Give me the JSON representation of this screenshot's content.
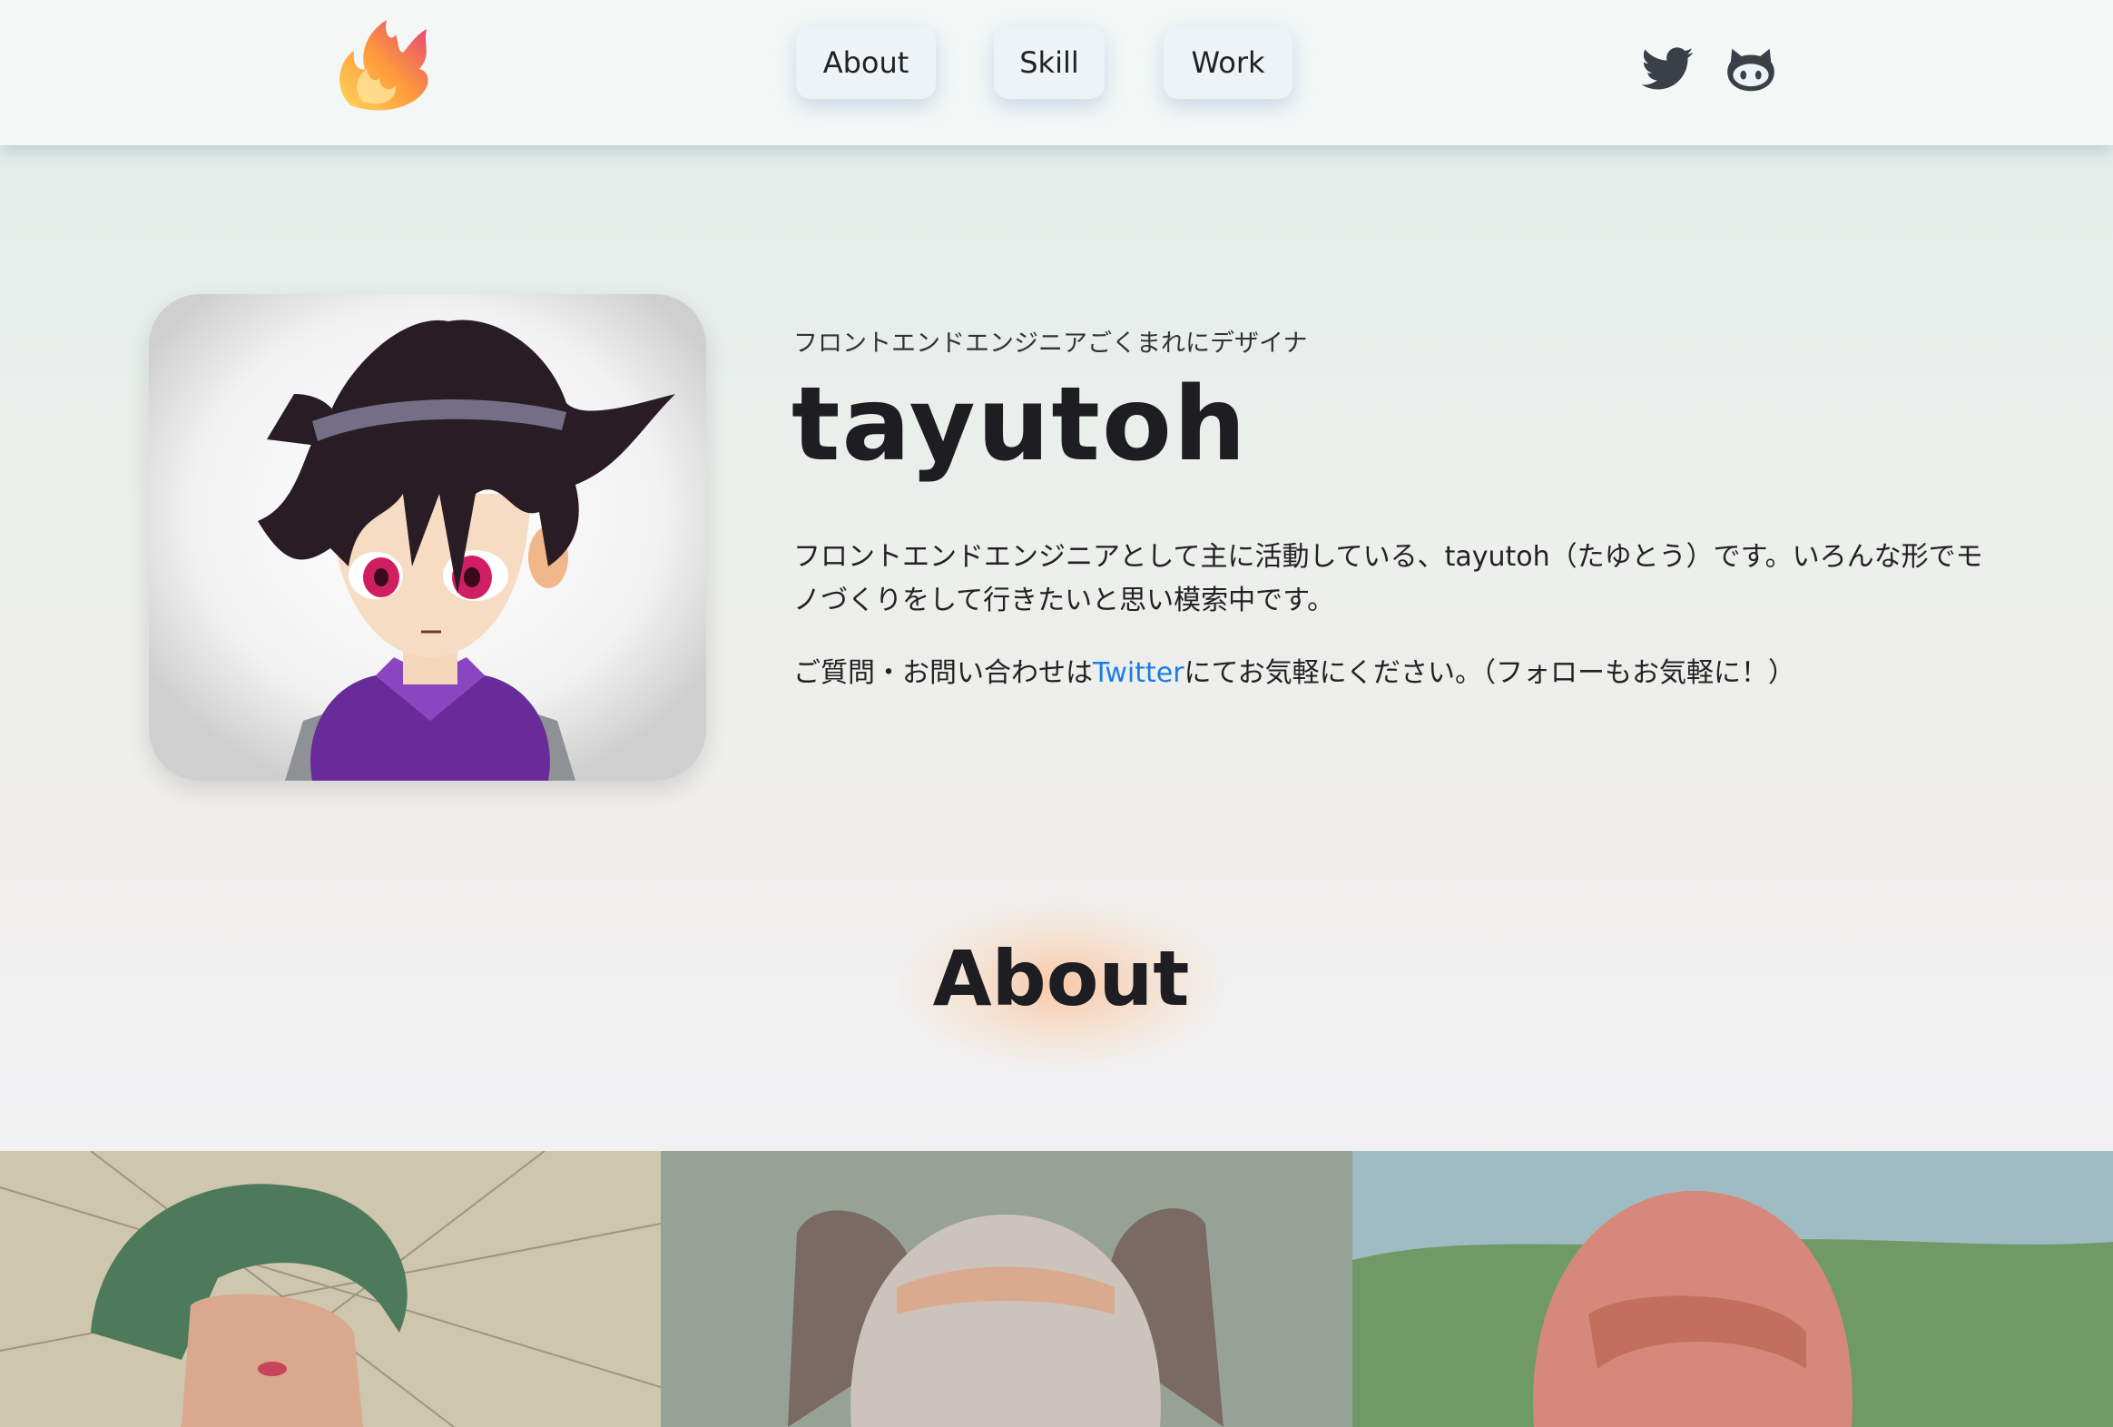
{
  "header": {
    "logo_icon": "flame-logo-icon",
    "nav": [
      {
        "label": "About"
      },
      {
        "label": "Skill"
      },
      {
        "label": "Work"
      }
    ],
    "social": [
      {
        "icon": "twitter-icon"
      },
      {
        "icon": "github-icon"
      }
    ]
  },
  "profile": {
    "tagline": "フロントエンドエンジニアごくまれにデザイナ",
    "name": "tayutoh",
    "bio": "フロントエンドエンジニアとして主に活動している、tayutoh（たゆとう）です。いろんな形でモノづくりをして行きたいと思い模索中です。",
    "contact_prefix": "ご質問・お問い合わせは",
    "contact_link": "Twitter",
    "contact_suffix": "にてお気軽にください。（フォローもお気軽に！）"
  },
  "about": {
    "heading": "About"
  },
  "colors": {
    "link": "#1a7ee6",
    "heading_glow": "#ffaa6e",
    "header_bg": "#f3f7f6"
  }
}
